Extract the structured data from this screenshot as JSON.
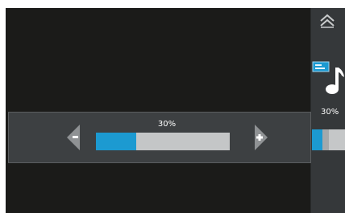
{
  "side_panel": {
    "collapse_icon": "double-chevron-up-icon",
    "media_icon": "media-player-icon",
    "note_icon": "music-note-icon",
    "volume_label": "30%",
    "volume_level": 0.3
  },
  "volume_osd": {
    "label": "30%",
    "level": 0.3,
    "decrease_icon": "arrow-left-icon",
    "increase_icon": "arrow-right-plus-icon"
  },
  "colors": {
    "accent": "#1c9ad1",
    "track": "#c4c6c7",
    "background": "#1b1b19",
    "panel": "#3d4042"
  }
}
